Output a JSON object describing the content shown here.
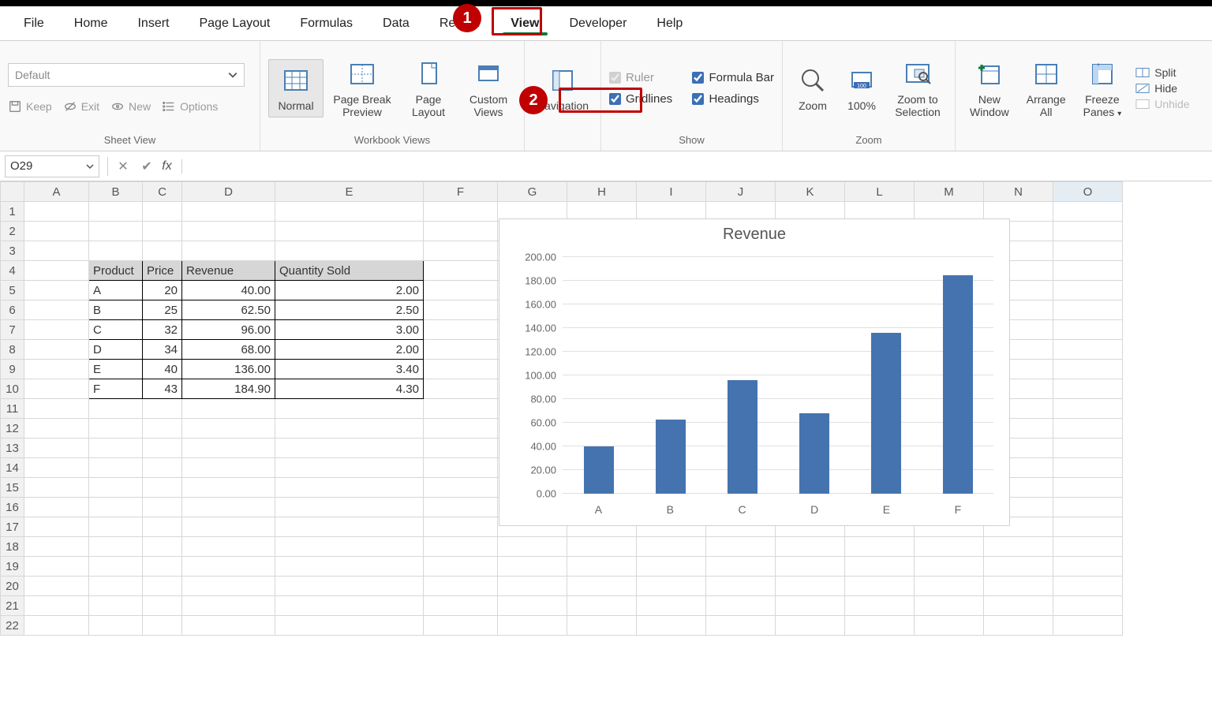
{
  "tabs": {
    "items": [
      "File",
      "Home",
      "Insert",
      "Page Layout",
      "Formulas",
      "Data",
      "Review",
      "View",
      "Developer",
      "Help"
    ],
    "active": "View"
  },
  "ribbon": {
    "sheetview": {
      "combo": "Default",
      "keep": "Keep",
      "exit": "Exit",
      "new": "New",
      "options": "Options",
      "label": "Sheet View"
    },
    "wbviews": {
      "normal": "Normal",
      "pagebreak": "Page Break Preview",
      "pagelayout": "Page Layout",
      "custom": "Custom Views",
      "navigation": "Navigation",
      "label": "Workbook Views"
    },
    "show": {
      "ruler": "Ruler",
      "formula": "Formula Bar",
      "gridlines": "Gridlines",
      "headings": "Headings",
      "label": "Show"
    },
    "zoom": {
      "zoom": "Zoom",
      "pct": "100%",
      "selection_l1": "Zoom to",
      "selection_l2": "Selection",
      "label": "Zoom"
    },
    "window": {
      "new_l1": "New",
      "new_l2": "Window",
      "arrange_l1": "Arrange",
      "arrange_l2": "All",
      "freeze_l1": "Freeze",
      "freeze_l2": "Panes",
      "split": "Split",
      "hide": "Hide",
      "unhide": "Unhide"
    }
  },
  "callouts": {
    "one": "1",
    "two": "2"
  },
  "formula_bar": {
    "cell": "O29",
    "value": ""
  },
  "columns": [
    "A",
    "B",
    "C",
    "D",
    "E",
    "F",
    "G",
    "H",
    "I",
    "J",
    "K",
    "L",
    "M",
    "N",
    "O"
  ],
  "rows": 22,
  "data_table": {
    "start_row": 4,
    "headers": [
      "Product",
      "Price",
      "Revenue",
      "Quantity Sold"
    ],
    "rows": [
      {
        "product": "A",
        "price": "20",
        "revenue": "40.00",
        "qty": "2.00"
      },
      {
        "product": "B",
        "price": "25",
        "revenue": "62.50",
        "qty": "2.50"
      },
      {
        "product": "C",
        "price": "32",
        "revenue": "96.00",
        "qty": "3.00"
      },
      {
        "product": "D",
        "price": "34",
        "revenue": "68.00",
        "qty": "2.00"
      },
      {
        "product": "E",
        "price": "40",
        "revenue": "136.00",
        "qty": "3.40"
      },
      {
        "product": "F",
        "price": "43",
        "revenue": "184.90",
        "qty": "4.30"
      }
    ]
  },
  "chart_data": {
    "type": "bar",
    "title": "Revenue",
    "categories": [
      "A",
      "B",
      "C",
      "D",
      "E",
      "F"
    ],
    "values": [
      40.0,
      62.5,
      96.0,
      68.0,
      136.0,
      184.9
    ],
    "ylim": [
      0,
      200
    ],
    "ystep": 20,
    "yticks": [
      "0.00",
      "20.00",
      "40.00",
      "60.00",
      "80.00",
      "100.00",
      "120.00",
      "140.00",
      "160.00",
      "180.00",
      "200.00"
    ]
  }
}
